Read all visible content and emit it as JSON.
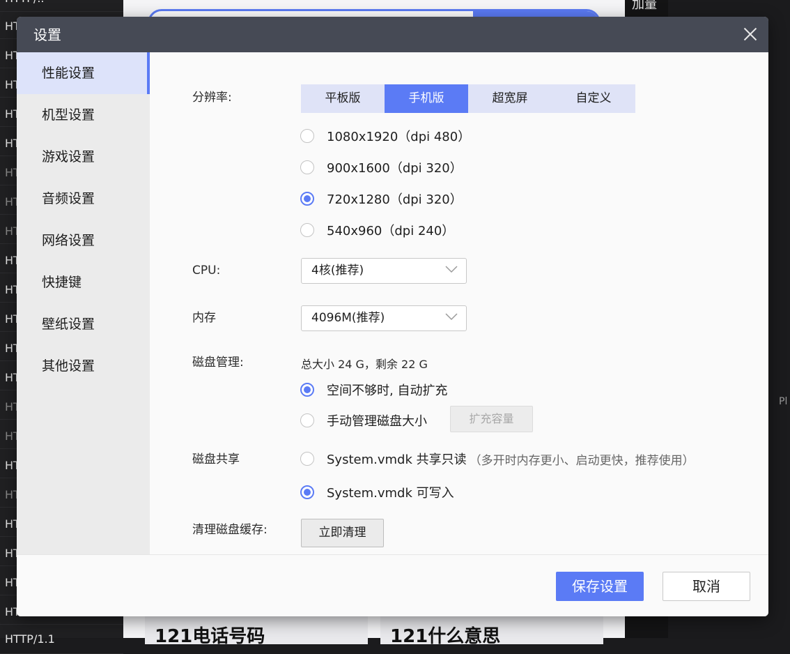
{
  "background": {
    "left_list": [
      {
        "label": "HTTP/..",
        "dim": false
      },
      {
        "label": "HT",
        "dim": false
      },
      {
        "label": "HT",
        "dim": false
      },
      {
        "label": "HT",
        "dim": false
      },
      {
        "label": "HT",
        "dim": false
      },
      {
        "label": "HT",
        "dim": false
      },
      {
        "label": "HT",
        "dim": true
      },
      {
        "label": "HT",
        "dim": true
      },
      {
        "label": "HT",
        "dim": true
      },
      {
        "label": "HT",
        "dim": false
      },
      {
        "label": "HT",
        "dim": false
      },
      {
        "label": "HT",
        "dim": false
      },
      {
        "label": "HT",
        "dim": false
      },
      {
        "label": "HT",
        "dim": false
      },
      {
        "label": "HT",
        "dim": true
      },
      {
        "label": "HT",
        "dim": true
      },
      {
        "label": "HT",
        "dim": false
      },
      {
        "label": "HT",
        "dim": true
      },
      {
        "label": "HT",
        "dim": false
      },
      {
        "label": "HT",
        "dim": false
      },
      {
        "label": "HT",
        "dim": false
      },
      {
        "label": "HT",
        "dim": false
      },
      {
        "label": "HTTP/1.1",
        "dim": false
      }
    ],
    "right_top_text": "加量",
    "right_side_text": "Pl",
    "bottom_cards": [
      "121电话号码",
      "121什么意思"
    ]
  },
  "dialog": {
    "title": "设置",
    "sidebar": [
      {
        "label": "性能设置",
        "active": true
      },
      {
        "label": "机型设置",
        "active": false
      },
      {
        "label": "游戏设置",
        "active": false
      },
      {
        "label": "音频设置",
        "active": false
      },
      {
        "label": "网络设置",
        "active": false
      },
      {
        "label": "快捷键",
        "active": false
      },
      {
        "label": "壁纸设置",
        "active": false
      },
      {
        "label": "其他设置",
        "active": false
      }
    ],
    "resolution": {
      "label": "分辨率:",
      "tabs": [
        {
          "label": "平板版",
          "active": false
        },
        {
          "label": "手机版",
          "active": true
        },
        {
          "label": "超宽屏",
          "active": false
        },
        {
          "label": "自定义",
          "active": false
        }
      ],
      "options": [
        {
          "label": "1080x1920（dpi 480）",
          "checked": false
        },
        {
          "label": "900x1600（dpi 320）",
          "checked": false
        },
        {
          "label": "720x1280（dpi 320）",
          "checked": true
        },
        {
          "label": "540x960（dpi 240）",
          "checked": false
        }
      ]
    },
    "cpu": {
      "label": "CPU:",
      "value": "4核(推荐)"
    },
    "memory": {
      "label": "内存",
      "value": "4096M(推荐)"
    },
    "disk": {
      "label": "磁盘管理:",
      "info": "总大小 24 G，剩余 22 G",
      "options": [
        {
          "label": "空间不够时, 自动扩充",
          "checked": true
        },
        {
          "label": "手动管理磁盘大小",
          "checked": false
        }
      ],
      "expand_button": "扩充容量"
    },
    "disk_share": {
      "label": "磁盘共享",
      "options": [
        {
          "label": "System.vmdk 共享只读",
          "note": "（多开时内存更小、启动更快，推荐使用）",
          "checked": false
        },
        {
          "label": "System.vmdk 可写入",
          "note": "",
          "checked": true
        }
      ]
    },
    "clean_cache": {
      "label": "清理磁盘缓存:",
      "button": "立即清理"
    },
    "footer": {
      "save": "保存设置",
      "cancel": "取消"
    }
  },
  "colors": {
    "accent": "#5b7bf5",
    "titlebar": "#464a55"
  }
}
